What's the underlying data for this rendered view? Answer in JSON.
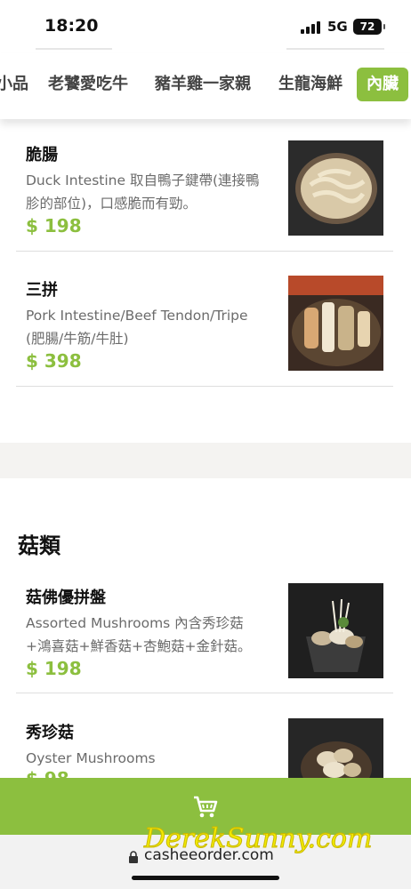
{
  "status": {
    "time": "18:20",
    "network": "5G",
    "battery": "72"
  },
  "tabs": [
    {
      "label": "小品",
      "active": false
    },
    {
      "label": "老饕愛吃牛",
      "active": false
    },
    {
      "label": "豬羊雞一家親",
      "active": false
    },
    {
      "label": "生龍海鮮",
      "active": false
    },
    {
      "label": "內臟",
      "active": true
    }
  ],
  "items": [
    {
      "name": "脆腸",
      "desc": "Duck Intestine 取自鴨子鍵帶(連接鴨胗的部位)，口感脆而有勁。",
      "price": "$ 198",
      "image": "duck-intestine-dish"
    },
    {
      "name": "三拼",
      "desc": "Pork Intestine/Beef Tendon/Tripe (肥腸/牛筋/牛肚)",
      "price": "$ 398",
      "image": "offal-platter-dish"
    },
    {
      "name": "菇佛優拼盤",
      "desc": "Assorted Mushrooms 內含秀珍菇+鴻喜菇+鮮香菇+杏鮑菇+金針菇。",
      "price": "$ 198",
      "image": "mushroom-platter-dish"
    },
    {
      "name": "秀珍菇",
      "desc": "Oyster Mushrooms",
      "price": "$ 98",
      "image": "oyster-mushroom-dish"
    }
  ],
  "section": {
    "title": "菇類"
  },
  "cart": {
    "icon": "cart-icon"
  },
  "browser": {
    "url": "casheeorder.com"
  },
  "watermark": "DerekSunny.com",
  "colors": {
    "accent": "#8cbf3f",
    "divider": "#f4f3f1",
    "url_bar": "#f2f2f2"
  }
}
